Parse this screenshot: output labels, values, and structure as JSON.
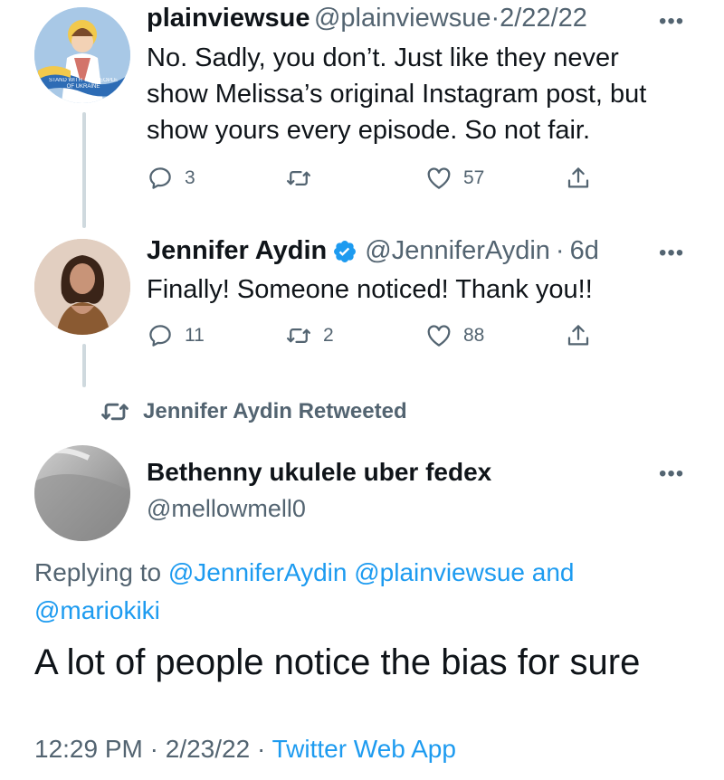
{
  "tweet1": {
    "name": "plainviewsue",
    "handle": "@plainviewsue",
    "sep": "·",
    "date": "2/22/22",
    "avatar_text": "STAND WITH THE PEOPLE OF UKRAINE",
    "lines": [
      "No. Sadly, you don’t. Just like they never",
      "show Melissa’s original Instagram post, but",
      "show yours every episode. So not fair."
    ],
    "replies": "3",
    "retweets": "",
    "likes": "57"
  },
  "tweet2": {
    "name": "Jennifer Aydin",
    "handle": "@JenniferAydin",
    "sep": "·",
    "date": "6d",
    "text": "Finally! Someone noticed! Thank you!!",
    "replies": "11",
    "retweets": "2",
    "likes": "88"
  },
  "retweet_banner": "Jennifer Aydin Retweeted",
  "main_tweet": {
    "name": "Bethenny ukulele uber fedex",
    "handle": "@mellowmell0",
    "replying_prefix": "Replying to",
    "replying_line1_mentions": [
      "@JenniferAydin",
      "@plainviewsue"
    ],
    "replying_and": "and",
    "replying_line2_mentions": [
      "@mariokiki"
    ],
    "text": "A lot of people notice the bias for sure",
    "time": "12:29 PM",
    "sep1": "·",
    "date": "2/23/22",
    "sep2": "·",
    "source": "Twitter Web App"
  },
  "more_icon": "•••",
  "colors": {
    "link": "#1d9bf0",
    "secondary": "#536471",
    "text": "#0f1419",
    "thread_line": "#cfd9de"
  },
  "icons": [
    "reply-icon",
    "retweet-icon",
    "like-icon",
    "share-icon",
    "verified-badge-icon",
    "more-icon"
  ]
}
